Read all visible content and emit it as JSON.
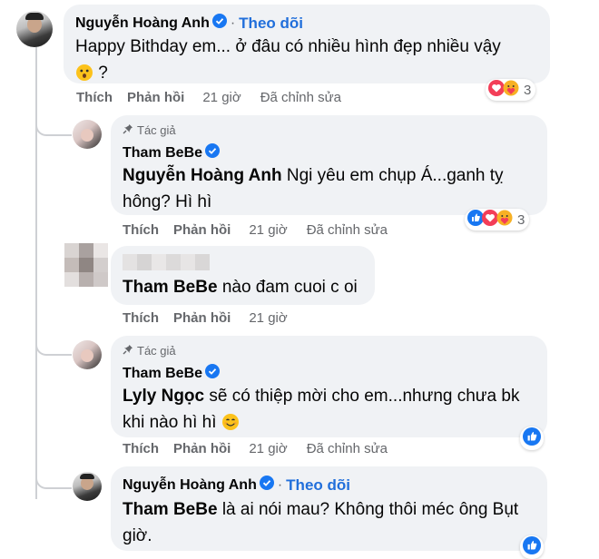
{
  "comments": [
    {
      "author": "Nguyễn Hoàng Anh",
      "follow": "Theo dõi",
      "text": "Happy Bithday em... ở đâu có nhiều hình đẹp nhiều vậy",
      "text_tail": "?",
      "actions": {
        "like": "Thích",
        "reply": "Phản hồi",
        "time": "21 giờ",
        "edited": "Đã chỉnh sửa"
      },
      "reaction_count": "3",
      "reactions": [
        "love",
        "care"
      ]
    },
    {
      "badge": "Tác giả",
      "author": "Tham BeBe",
      "mention": "Nguyễn Hoàng Anh",
      "text": "Ngi yêu em chụp Á...ganh tỵ hông? Hì hì",
      "actions": {
        "like": "Thích",
        "reply": "Phản hồi",
        "time": "21 giờ",
        "edited": "Đã chỉnh sửa"
      },
      "reaction_count": "3",
      "reactions": [
        "like",
        "love",
        "care"
      ]
    },
    {
      "mention": "Tham BeBe",
      "text": "nào đam cuoi c oi",
      "actions": {
        "like": "Thích",
        "reply": "Phản hồi",
        "time": "21 giờ"
      }
    },
    {
      "badge": "Tác giả",
      "author": "Tham BeBe",
      "mention": "Lyly Ngọc",
      "text": "sẽ có thiệp mời cho em...nhưng chưa bk khi nào hì hì",
      "actions": {
        "like": "Thích",
        "reply": "Phản hồi",
        "time": "21 giờ",
        "edited": "Đã chỉnh sửa"
      },
      "reactions": [
        "like"
      ]
    },
    {
      "author": "Nguyễn Hoàng Anh",
      "follow": "Theo dõi",
      "mention": "Tham BeBe",
      "text": "là ai nói mau? Không thôi méc ông Bụt giờ.",
      "reactions": [
        "like"
      ]
    }
  ],
  "colors": {
    "bubble": "#f0f2f5",
    "link": "#216fdb",
    "muted": "#65676b",
    "like": "#1877f2",
    "love": "#f33e58"
  }
}
